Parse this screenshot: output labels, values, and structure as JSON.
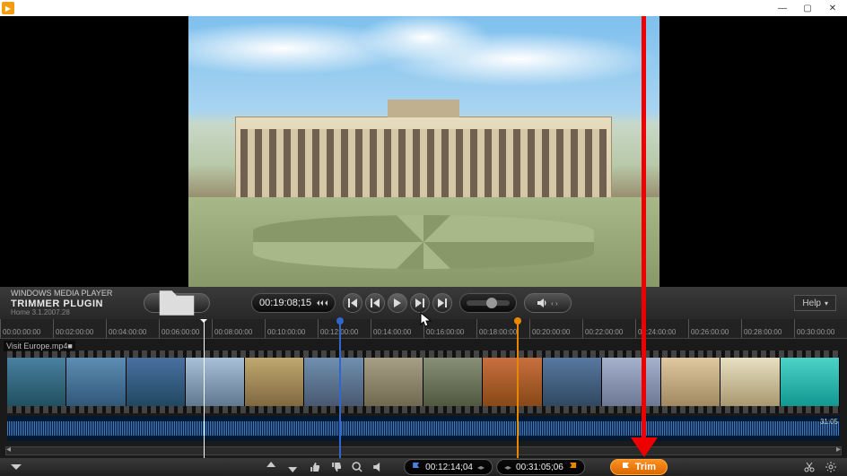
{
  "titlebar": {
    "app_icon": "▶",
    "min": "—",
    "max": "▢",
    "close": "✕"
  },
  "brand": {
    "line1": "WINDOWS MEDIA PLAYER",
    "line2": "TRIMMER PLUGIN",
    "line3": "Home 3.1.2007.28"
  },
  "playback": {
    "current_time": "00:19:08;15",
    "help_label": "Help"
  },
  "ruler_ticks": [
    "00:00:00:00",
    "00:02:00:00",
    "00:04:00:00",
    "00:06:00:00",
    "00:08:00:00",
    "00:10:00:00",
    "00:12:00:00",
    "00:14:00:00",
    "00:16:00:00",
    "00:18:00:00",
    "00:20:00:00",
    "00:22:00:00",
    "00:24:00:00",
    "00:26:00:00",
    "00:28:00:00",
    "00:30:00:00"
  ],
  "track": {
    "filename": "Visit Europe.mp4■",
    "duration_label": "31:05"
  },
  "bottom": {
    "in_time": "00:12:14;04",
    "out_time": "00:31:05;06",
    "trim_label": "Trim"
  },
  "icons": {
    "folder": "folder-icon",
    "step_frame": "step-frame-icon",
    "prev": "prev-icon",
    "step_back": "step-back-icon",
    "play": "play-icon",
    "step_fwd": "step-fwd-icon",
    "next": "next-icon",
    "speaker": "speaker-icon",
    "expand": "expand-icon",
    "zoom_in": "zoom-in-icon",
    "zoom_out": "zoom-out-icon",
    "thumbs_up": "thumbs-up-icon",
    "thumbs_down": "thumbs-down-icon",
    "mag": "magnifier-icon",
    "mute": "mute-icon",
    "goto_in": "goto-in-icon",
    "set_in": "set-in-icon",
    "set_out": "set-out-icon",
    "goto_out": "goto-out-icon",
    "flag": "flag-icon",
    "scissors": "scissors-icon",
    "gear": "gear-icon"
  }
}
